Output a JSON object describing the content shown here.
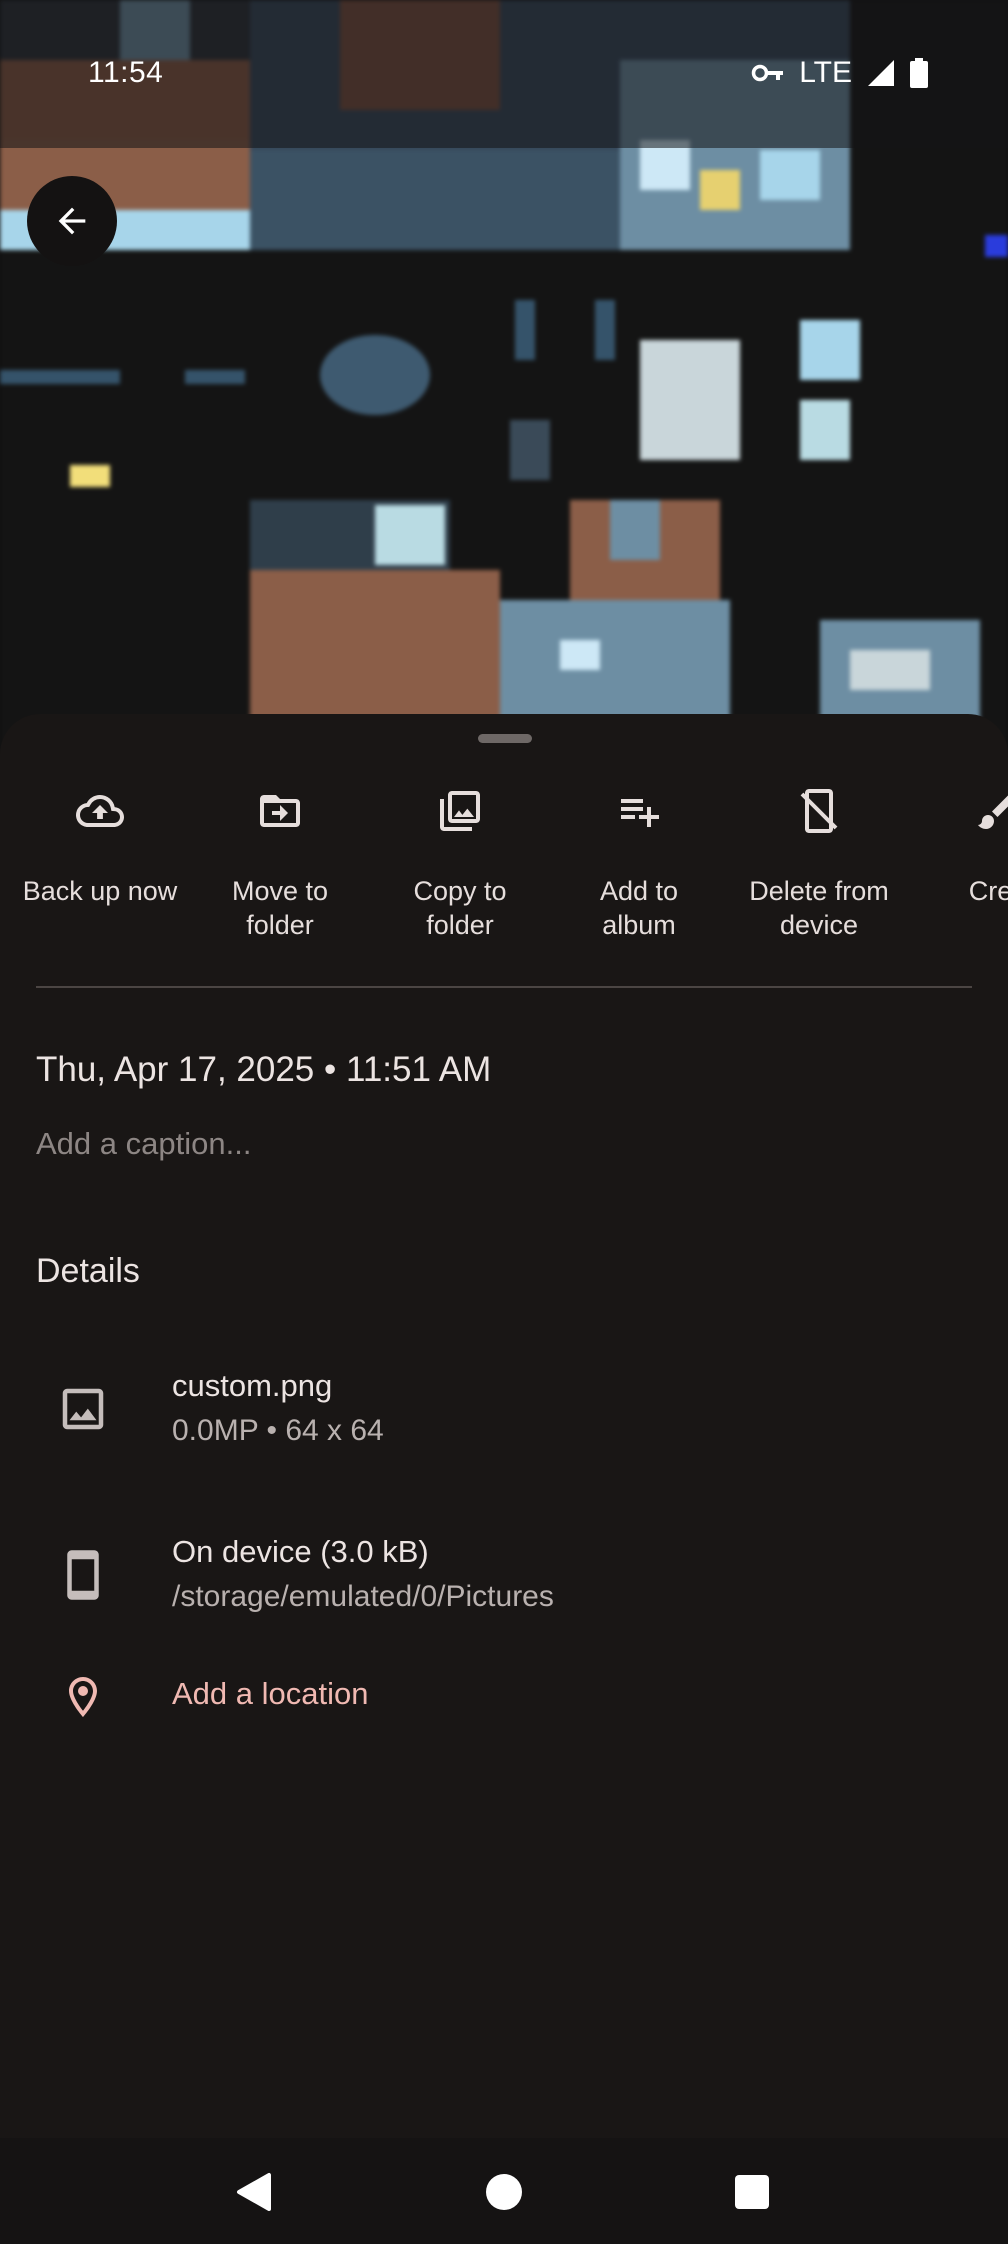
{
  "status_bar": {
    "time": "11:54",
    "network": "LTE",
    "icons": [
      "vpn-key-icon",
      "signal-icon",
      "battery-icon"
    ]
  },
  "photo": {
    "description_icon": "pixel-art-image"
  },
  "actions": [
    {
      "label_line1": "Back up now",
      "label_line2": "",
      "icon": "cloud-upload-icon"
    },
    {
      "label_line1": "Move to",
      "label_line2": "folder",
      "icon": "move-folder-icon"
    },
    {
      "label_line1": "Copy to",
      "label_line2": "folder",
      "icon": "copy-images-icon"
    },
    {
      "label_line1": "Add to",
      "label_line2": "album",
      "icon": "playlist-add-icon"
    },
    {
      "label_line1": "Delete from",
      "label_line2": "device",
      "icon": "delete-device-icon"
    },
    {
      "label_line1": "Crea",
      "label_line2": "",
      "icon": "brush-icon"
    }
  ],
  "info": {
    "datetime": "Thu, Apr 17, 2025  •  11:51 AM",
    "caption_placeholder": "Add a caption..."
  },
  "details": {
    "title": "Details",
    "file": {
      "name": "custom.png",
      "meta": "0.0MP  •  64 x 64"
    },
    "storage": {
      "name": "On device (3.0 kB)",
      "path": "/storage/emulated/0/Pictures"
    },
    "location": {
      "label": "Add a location"
    }
  },
  "colors": {
    "background": "#191615",
    "accent_link": "#f0b9b2"
  }
}
